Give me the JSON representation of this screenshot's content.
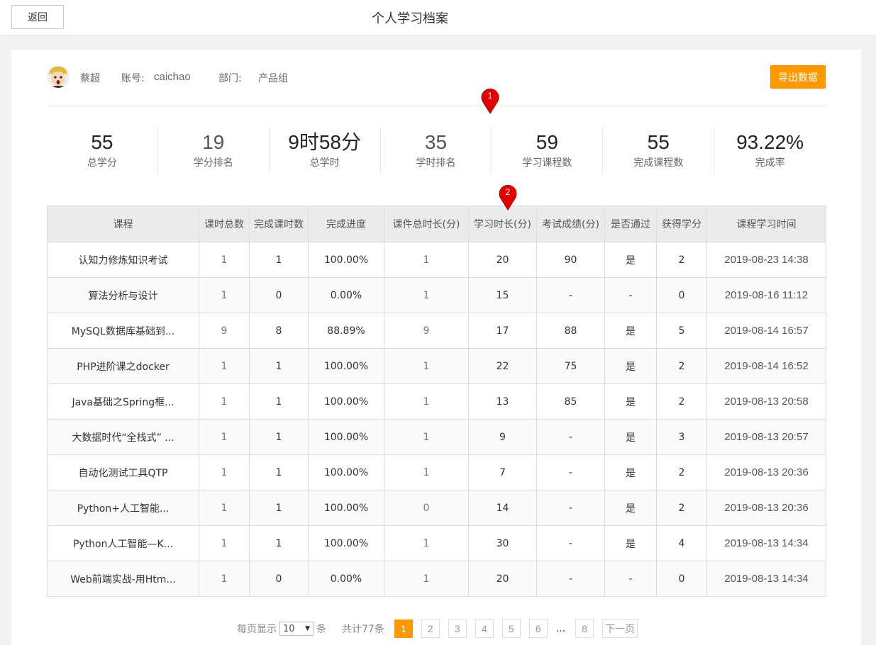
{
  "header": {
    "back_label": "返回",
    "title": "个人学习档案"
  },
  "user": {
    "name": "蔡超",
    "account_label": "账号:",
    "account": "caichao",
    "dept_label": "部门:",
    "dept": "产品组",
    "export_label": "导出数据"
  },
  "stats": [
    {
      "value": "55",
      "label": "总学分"
    },
    {
      "value": "19",
      "label": "学分排名"
    },
    {
      "value": "9时58分",
      "label": "总学时"
    },
    {
      "value": "35",
      "label": "学时排名"
    },
    {
      "value": "59",
      "label": "学习课程数"
    },
    {
      "value": "55",
      "label": "完成课程数"
    },
    {
      "value": "93.22%",
      "label": "完成率"
    }
  ],
  "markers": [
    "1",
    "2"
  ],
  "table": {
    "headers": [
      "课程",
      "课时总数",
      "完成课时数",
      "完成进度",
      "课件总时长(分)",
      "学习时长(分)",
      "考试成绩(分)",
      "是否通过",
      "获得学分",
      "课程学习时间"
    ],
    "rows": [
      [
        "认知力修炼知识考试",
        "1",
        "1",
        "100.00%",
        "1",
        "20",
        "90",
        "是",
        "2",
        "2019-08-23 14:38"
      ],
      [
        "算法分析与设计",
        "1",
        "0",
        "0.00%",
        "1",
        "15",
        "-",
        "-",
        "0",
        "2019-08-16 11:12"
      ],
      [
        "MySQL数据库基础到...",
        "9",
        "8",
        "88.89%",
        "9",
        "17",
        "88",
        "是",
        "5",
        "2019-08-14 16:57"
      ],
      [
        "PHP进阶课之docker",
        "1",
        "1",
        "100.00%",
        "1",
        "22",
        "75",
        "是",
        "2",
        "2019-08-14 16:52"
      ],
      [
        "Java基础之Spring框...",
        "1",
        "1",
        "100.00%",
        "1",
        "13",
        "85",
        "是",
        "2",
        "2019-08-13 20:58"
      ],
      [
        "大数据时代“全栈式” ...",
        "1",
        "1",
        "100.00%",
        "1",
        "9",
        "-",
        "是",
        "3",
        "2019-08-13 20:57"
      ],
      [
        "自动化测试工具QTP",
        "1",
        "1",
        "100.00%",
        "1",
        "7",
        "-",
        "是",
        "2",
        "2019-08-13 20:36"
      ],
      [
        "Python+人工智能...",
        "1",
        "1",
        "100.00%",
        "0",
        "14",
        "-",
        "是",
        "2",
        "2019-08-13 20:36"
      ],
      [
        "Python人工智能—K...",
        "1",
        "1",
        "100.00%",
        "1",
        "30",
        "-",
        "是",
        "4",
        "2019-08-13 14:34"
      ],
      [
        "Web前端实战-用Htm...",
        "1",
        "0",
        "0.00%",
        "1",
        "20",
        "-",
        "-",
        "0",
        "2019-08-13 14:34"
      ]
    ]
  },
  "pager": {
    "per_page_label": "每页显示",
    "per_page_value": "10",
    "per_page_unit": "条",
    "total_label": "共计77条",
    "pages": [
      "1",
      "2",
      "3",
      "4",
      "5",
      "6"
    ],
    "ellipsis": "...",
    "last_page": "8",
    "next_label": "下一页"
  },
  "colors": {
    "accent": "#ff9900",
    "marker": "#e00000"
  }
}
